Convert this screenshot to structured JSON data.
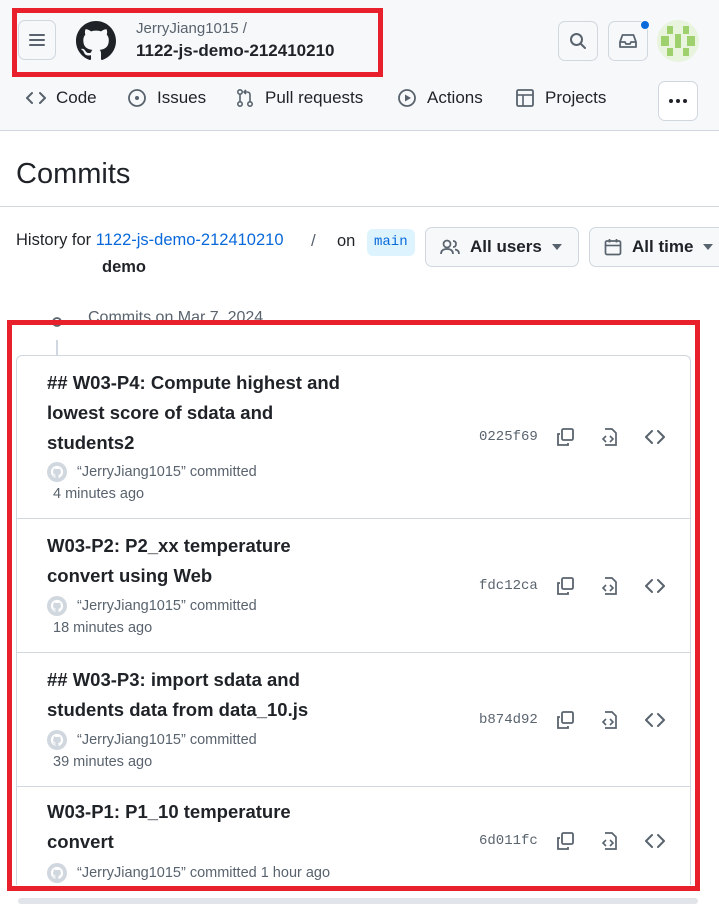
{
  "header": {
    "owner": "JerryJiang1015 /",
    "repo": "1122-js-demo-212410210"
  },
  "nav": {
    "items": [
      {
        "label": "Code"
      },
      {
        "label": "Issues"
      },
      {
        "label": "Pull requests"
      },
      {
        "label": "Actions"
      },
      {
        "label": "Projects"
      }
    ]
  },
  "page": {
    "title": "Commits",
    "history_prefix": "History for ",
    "history_repo": "1122-js-demo-212410210",
    "history_sep": "/",
    "history_path": "demo",
    "on_label": "on",
    "branch": "main",
    "users_filter": "All users",
    "time_filter": "All time",
    "commits_on": "Commits on Mar 7, 2024"
  },
  "commits": [
    {
      "title_lines": [
        "## W03-P4: Compute highest and",
        "lowest score of sdata and",
        "students2"
      ],
      "author": "“JerryJiang1015” committed",
      "time": "4 minutes ago",
      "sha": "0225f69"
    },
    {
      "title_lines": [
        "W03-P2: P2_xx temperature",
        "convert using Web"
      ],
      "author": "“JerryJiang1015” committed",
      "time": "18 minutes ago",
      "sha": "fdc12ca"
    },
    {
      "title_lines": [
        "## W03-P3: import sdata and",
        "students data from data_10.js"
      ],
      "author": "“JerryJiang1015” committed",
      "time": "39 minutes ago",
      "sha": "b874d92"
    },
    {
      "title_lines": [
        "W03-P1: P1_10 temperature",
        "convert"
      ],
      "author": "“JerryJiang1015” committed",
      "time": "1 hour ago",
      "sha": "6d011fc"
    }
  ],
  "colors": {
    "accent": "#0969da",
    "highlight_box": "#e8202c",
    "border": "#d0d7de"
  }
}
